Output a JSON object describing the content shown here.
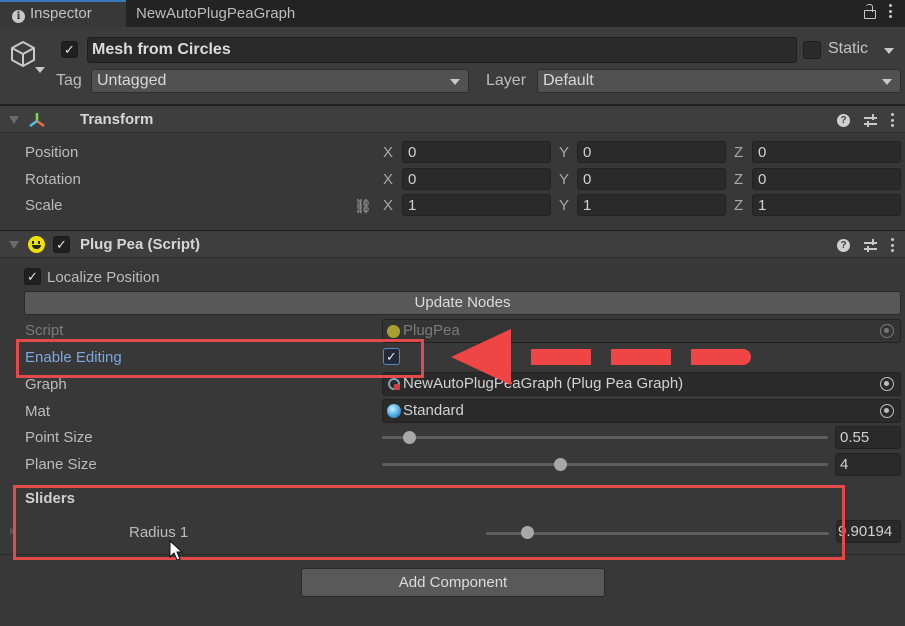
{
  "tabs": [
    {
      "label": "Inspector",
      "icon": "info-icon",
      "active": true
    },
    {
      "label": "NewAutoPlugPeaGraph",
      "active": false
    }
  ],
  "tab_tools": {
    "lock": "lock-icon",
    "menu": "kebab-icon"
  },
  "gameobject": {
    "active": true,
    "name": "Mesh from Circles",
    "static_label": "Static",
    "static": false,
    "tag_label": "Tag",
    "tag": "Untagged",
    "layer_label": "Layer",
    "layer": "Default"
  },
  "transform": {
    "title": "Transform",
    "rows": [
      {
        "label": "Position",
        "x": "0",
        "y": "0",
        "z": "0"
      },
      {
        "label": "Rotation",
        "x": "0",
        "y": "0",
        "z": "0"
      },
      {
        "label": "Scale",
        "x": "1",
        "y": "1",
        "z": "1"
      }
    ],
    "axis_labels": {
      "x": "X",
      "y": "Y",
      "z": "Z"
    }
  },
  "plugpea": {
    "title": "Plug Pea (Script)",
    "enabled": true,
    "localize_position_label": "Localize Position",
    "localize_position": true,
    "update_nodes_label": "Update Nodes",
    "script_label": "Script",
    "script_value": "PlugPea",
    "enable_editing_label": "Enable Editing",
    "enable_editing": true,
    "graph_label": "Graph",
    "graph_value": "NewAutoPlugPeaGraph (Plug Pea Graph)",
    "mat_label": "Mat",
    "mat_value": "Standard",
    "point_size_label": "Point Size",
    "point_size_value": "0.55",
    "point_size_fraction": 0.06,
    "plane_size_label": "Plane Size",
    "plane_size_value": "4",
    "plane_size_fraction": 0.4,
    "sliders_label": "Sliders",
    "radius_label": "Radius 1",
    "radius_value": "9.90194",
    "radius_fraction": 0.12
  },
  "add_component_label": "Add Component",
  "annotation_color": "#e34a4a"
}
